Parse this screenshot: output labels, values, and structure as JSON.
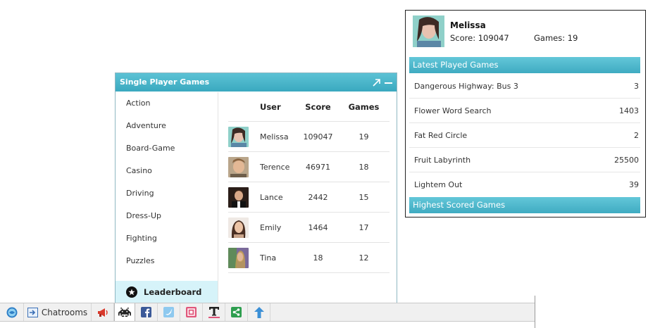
{
  "games_panel": {
    "title": "Single Player Games",
    "categories": [
      "Action",
      "Adventure",
      "Board-Game",
      "Casino",
      "Driving",
      "Dress-Up",
      "Fighting",
      "Puzzles"
    ],
    "leaderboard_label": "Leaderboard",
    "table": {
      "headers": {
        "user": "User",
        "score": "Score",
        "games": "Games"
      },
      "rows": [
        {
          "user": "Melissa",
          "score": "109047",
          "games": "19"
        },
        {
          "user": "Terence",
          "score": "46971",
          "games": "18"
        },
        {
          "user": "Lance",
          "score": "2442",
          "games": "15"
        },
        {
          "user": "Emily",
          "score": "1464",
          "games": "17"
        },
        {
          "user": "Tina",
          "score": "18",
          "games": "12"
        }
      ]
    }
  },
  "profile": {
    "name": "Melissa",
    "score_text": "Score: 109047",
    "games_text": "Games: 19",
    "latest_title": "Latest Played Games",
    "latest_games": [
      {
        "name": "Dangerous Highway: Bus 3",
        "value": "3"
      },
      {
        "name": "Flower Word Search",
        "value": "1403"
      },
      {
        "name": "Fat Red Circle",
        "value": "2"
      },
      {
        "name": "Fruit Labyrinth",
        "value": "25500"
      },
      {
        "name": "Lightem Out",
        "value": "39"
      }
    ],
    "highest_title": "Highest Scored Games"
  },
  "toolbar": {
    "chatrooms_label": "Chatrooms",
    "icons": [
      "globe-icon",
      "chatrooms-icon",
      "announcement-icon",
      "games-icon",
      "facebook-icon",
      "twitter-icon",
      "notes-icon",
      "text-icon",
      "share-icon",
      "upload-icon"
    ]
  },
  "colors": {
    "header_teal": "#3aa9bf",
    "leaderboard_bg": "#d6f3f9",
    "facebook": "#3b5998",
    "twitter": "#55acee",
    "share": "#2e9e4f",
    "upload": "#3b8fd6"
  }
}
